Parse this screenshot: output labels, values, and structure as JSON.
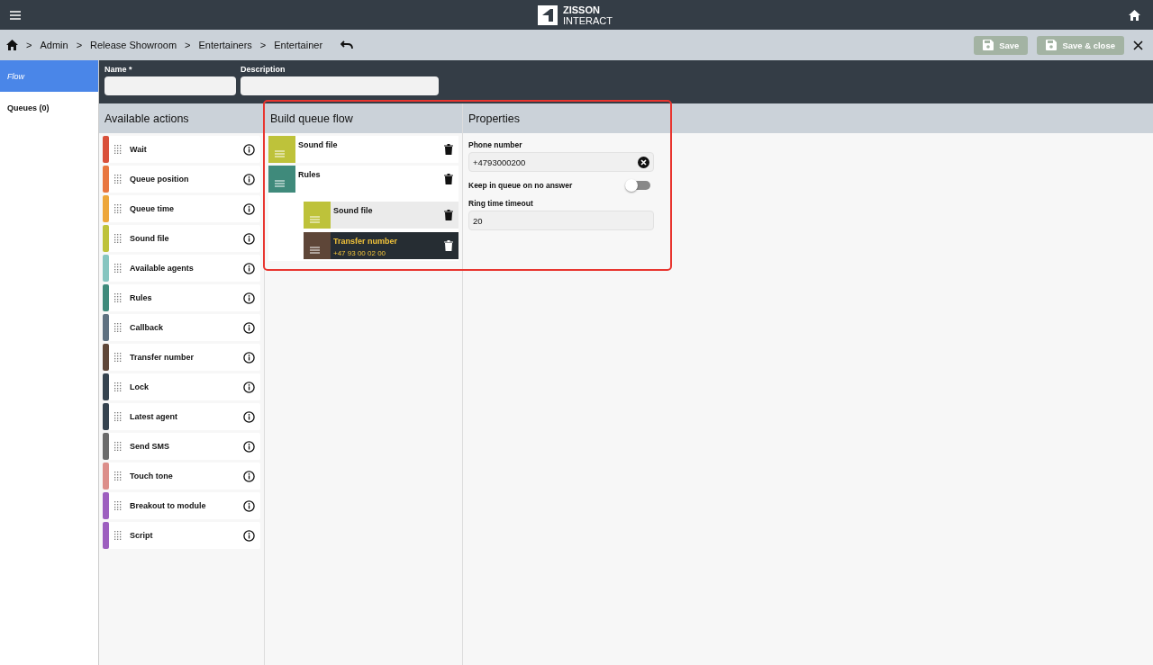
{
  "app": {
    "logo_line1": "ZISSON",
    "logo_line2": "INTERACT"
  },
  "breadcrumb": [
    "Admin",
    "Release Showroom",
    "Entertainers",
    "Entertainer"
  ],
  "breadcrumb_separator": ">",
  "buttons": [
    {
      "label": "Save",
      "disabled": true
    },
    {
      "label": "Save & close",
      "disabled": true
    }
  ],
  "sidebar": {
    "items": [
      {
        "label": "Flow",
        "selected": true
      },
      {
        "label": "Queues (0)",
        "selected": false
      }
    ]
  },
  "form": {
    "name": {
      "label": "Name *"
    },
    "description": {
      "label": "Description"
    }
  },
  "available_actions": {
    "title": "Available actions",
    "items": [
      {
        "label": "Wait",
        "color": "#d9503a"
      },
      {
        "label": "Queue position",
        "color": "#e8763f"
      },
      {
        "label": "Queue time",
        "color": "#eda63a"
      },
      {
        "label": "Sound file",
        "color": "#bec23a"
      },
      {
        "label": "Available agents",
        "color": "#86c5c0"
      },
      {
        "label": "Rules",
        "color": "#3f8a7b"
      },
      {
        "label": "Callback",
        "color": "#5f7181"
      },
      {
        "label": "Transfer number",
        "color": "#5e4638"
      },
      {
        "label": "Lock",
        "color": "#35434f"
      },
      {
        "label": "Latest agent",
        "color": "#35434f"
      },
      {
        "label": "Send SMS",
        "color": "#6b6b6b"
      },
      {
        "label": "Touch tone",
        "color": "#dc8e8a"
      },
      {
        "label": "Breakout to module",
        "color": "#9d5fbf"
      },
      {
        "label": "Script",
        "color": "#9d5fbf"
      }
    ]
  },
  "flow": {
    "title": "Build queue flow",
    "items": [
      {
        "label": "Sound file",
        "color": "#bec23a",
        "selected": false
      },
      {
        "label": "Rules",
        "color": "#3f8a7b",
        "selected": false,
        "children": [
          {
            "label": "Sound file",
            "color": "#bec23a",
            "selected": false
          },
          {
            "label": "Transfer number",
            "subtitle": "+47 93 00 02 00",
            "color": "#5e4638",
            "selected": true
          }
        ]
      }
    ]
  },
  "properties": {
    "title": "Properties",
    "fields": [
      {
        "kind": "text",
        "label": "Phone number",
        "value": "+4793000200",
        "clearable": true
      },
      {
        "kind": "toggle",
        "label": "Keep in queue on no answer",
        "on": false
      },
      {
        "kind": "text",
        "label": "Ring time timeout",
        "value": "20",
        "clearable": false
      }
    ]
  }
}
